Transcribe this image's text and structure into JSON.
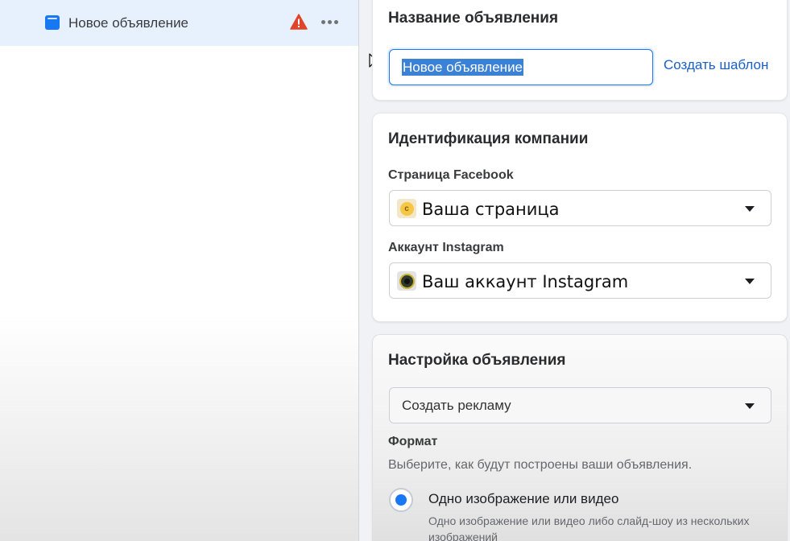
{
  "sidebar": {
    "item": {
      "label": "Новое объявление",
      "icon": "ad-icon",
      "status_icon": "warning-icon",
      "status_color": "#e0452b",
      "more_icon": "more-icon"
    }
  },
  "ad_name": {
    "title": "Название объявления",
    "input_value": "Новое объявление",
    "template_link": "Создать шаблон"
  },
  "identity": {
    "title": "Идентификация компании",
    "facebook_label": "Страница Facebook",
    "facebook_value": "Ваша страница",
    "facebook_thumb_letter": "c",
    "instagram_label": "Аккаунт Instagram",
    "instagram_value": "Ваш аккаунт Instagram"
  },
  "ad_setup": {
    "title": "Настройка объявления",
    "create_select": "Создать рекламу",
    "format_label": "Формат",
    "format_hint": "Выберите, как будут построены ваши объявления.",
    "option_label": "Одно изображение или видео",
    "option_desc": "Одно изображение или видео либо слайд-шоу из нескольких изображений",
    "option_selected": true
  },
  "colors": {
    "accent": "#1877f2",
    "selection": "#3b82d6",
    "link": "#1a5fc7",
    "sidebar_active": "#e7f0fd"
  }
}
